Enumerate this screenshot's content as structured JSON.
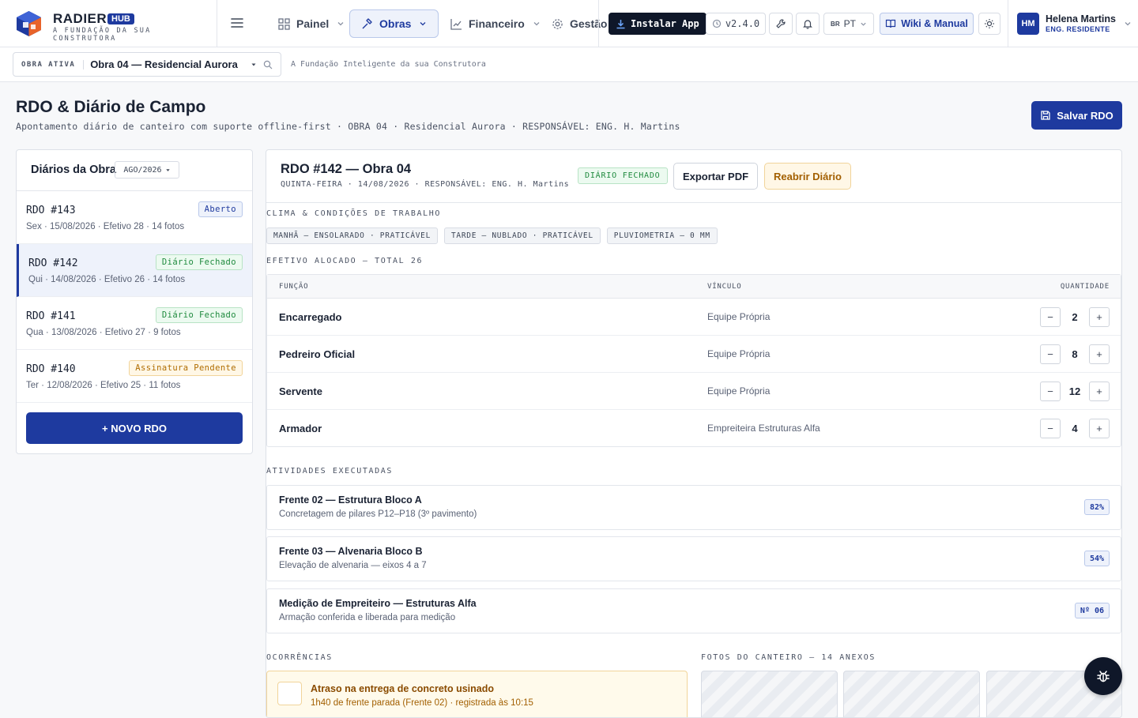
{
  "brand": {
    "name": "RADIER",
    "badge": "HUB",
    "tagline": "A FUNDAÇÃO DA SUA CONSTRUTORA"
  },
  "nav": {
    "items": [
      {
        "label": "Painel",
        "icon": "grid-icon"
      },
      {
        "label": "Obras",
        "icon": "hammer-icon",
        "active": true
      },
      {
        "label": "Financeiro",
        "icon": "chart-line-icon"
      },
      {
        "label": "Gestão",
        "icon": "gear-icon"
      }
    ]
  },
  "toolbar": {
    "install_label": "Instalar App",
    "version": "v2.4.0",
    "lang_flag": "BR",
    "lang": "PT",
    "wiki_label": "Wiki & Manual"
  },
  "user": {
    "initials": "HM",
    "name": "Helena Martins",
    "role": "ENG. RESIDENTE"
  },
  "subbar": {
    "obra_label": "OBRA ATIVA",
    "obra_value": "Obra 04 — Residencial Aurora",
    "tagline": "A Fundação Inteligente da sua Construtora"
  },
  "page": {
    "title": "RDO & Diário de Campo",
    "subtitle": "Apontamento diário de canteiro com suporte offline-first · OBRA 04 · Residencial Aurora · RESPONSÁVEL: ENG. H. Martins",
    "save_label": "Salvar RDO"
  },
  "diaries": {
    "title": "Diários da Obra",
    "month": "AGO/2026",
    "items": [
      {
        "num": "RDO #143",
        "meta": "Sex · 15/08/2026 · Efetivo 28 · 14 fotos",
        "status": "Aberto"
      },
      {
        "num": "RDO #142",
        "meta": "Qui · 14/08/2026 · Efetivo 26 · 14 fotos",
        "status": "Diário Fechado"
      },
      {
        "num": "RDO #141",
        "meta": "Qua · 13/08/2026 · Efetivo 27 · 9 fotos",
        "status": "Diário Fechado"
      },
      {
        "num": "RDO #140",
        "meta": "Ter · 12/08/2026 · Efetivo 25 · 11 fotos",
        "status": "Assinatura Pendente"
      }
    ],
    "new_label": "+ NOVO RDO"
  },
  "rdo": {
    "title": "RDO #142 — Obra 04",
    "subtitle": "QUINTA-FEIRA · 14/08/2026 · RESPONSÁVEL: ENG. H. Martins",
    "status": "DIÁRIO FECHADO",
    "export_label": "Exportar PDF",
    "reopen_label": "Reabrir Diário"
  },
  "weather": {
    "label": "CLIMA & CONDIÇÕES DE TRABALHO",
    "chips": [
      "MANHÃ — ENSOLARADO · PRATICÁVEL",
      "TARDE — NUBLADO · PRATICÁVEL",
      "PLUVIOMETRIA — 0 MM"
    ]
  },
  "staff": {
    "label": "EFETIVO ALOCADO — TOTAL 26",
    "headers": {
      "funcao": "FUNÇÃO",
      "vinculo": "VÍNCULO",
      "quantidade": "QUANTIDADE"
    },
    "rows": [
      {
        "funcao": "Encarregado",
        "vinculo": "Equipe Própria",
        "qtd": "2"
      },
      {
        "funcao": "Pedreiro Oficial",
        "vinculo": "Equipe Própria",
        "qtd": "8"
      },
      {
        "funcao": "Servente",
        "vinculo": "Equipe Própria",
        "qtd": "12"
      },
      {
        "funcao": "Armador",
        "vinculo": "Empreiteira Estruturas Alfa",
        "qtd": "4"
      }
    ],
    "minus": "−",
    "plus": "+"
  },
  "activities": {
    "label": "ATIVIDADES EXECUTADAS",
    "items": [
      {
        "title": "Frente 02 — Estrutura Bloco A",
        "desc": "Concretagem de pilares P12–P18 (3º pavimento)",
        "tag": "82%"
      },
      {
        "title": "Frente 03 — Alvenaria Bloco B",
        "desc": "Elevação de alvenaria — eixos 4 a 7",
        "tag": "54%"
      },
      {
        "title": "Medição de Empreiteiro — Estruturas Alfa",
        "desc": "Armação conferida e liberada para medição",
        "tag": "Nº 06"
      }
    ]
  },
  "occurrences": {
    "label": "OCORRÊNCIAS",
    "items": [
      {
        "title": "Atraso na entrega de concreto usinado",
        "desc": "1h40 de frente parada (Frente 02) · registrada às 10:15"
      }
    ]
  },
  "photos": {
    "label": "FOTOS DO CANTEIRO — 14 ANEXOS"
  },
  "colors": {
    "primary": "#1e3a9f",
    "dark": "#0f1729",
    "success": "#1f8a3e",
    "warning": "#b06d00"
  }
}
